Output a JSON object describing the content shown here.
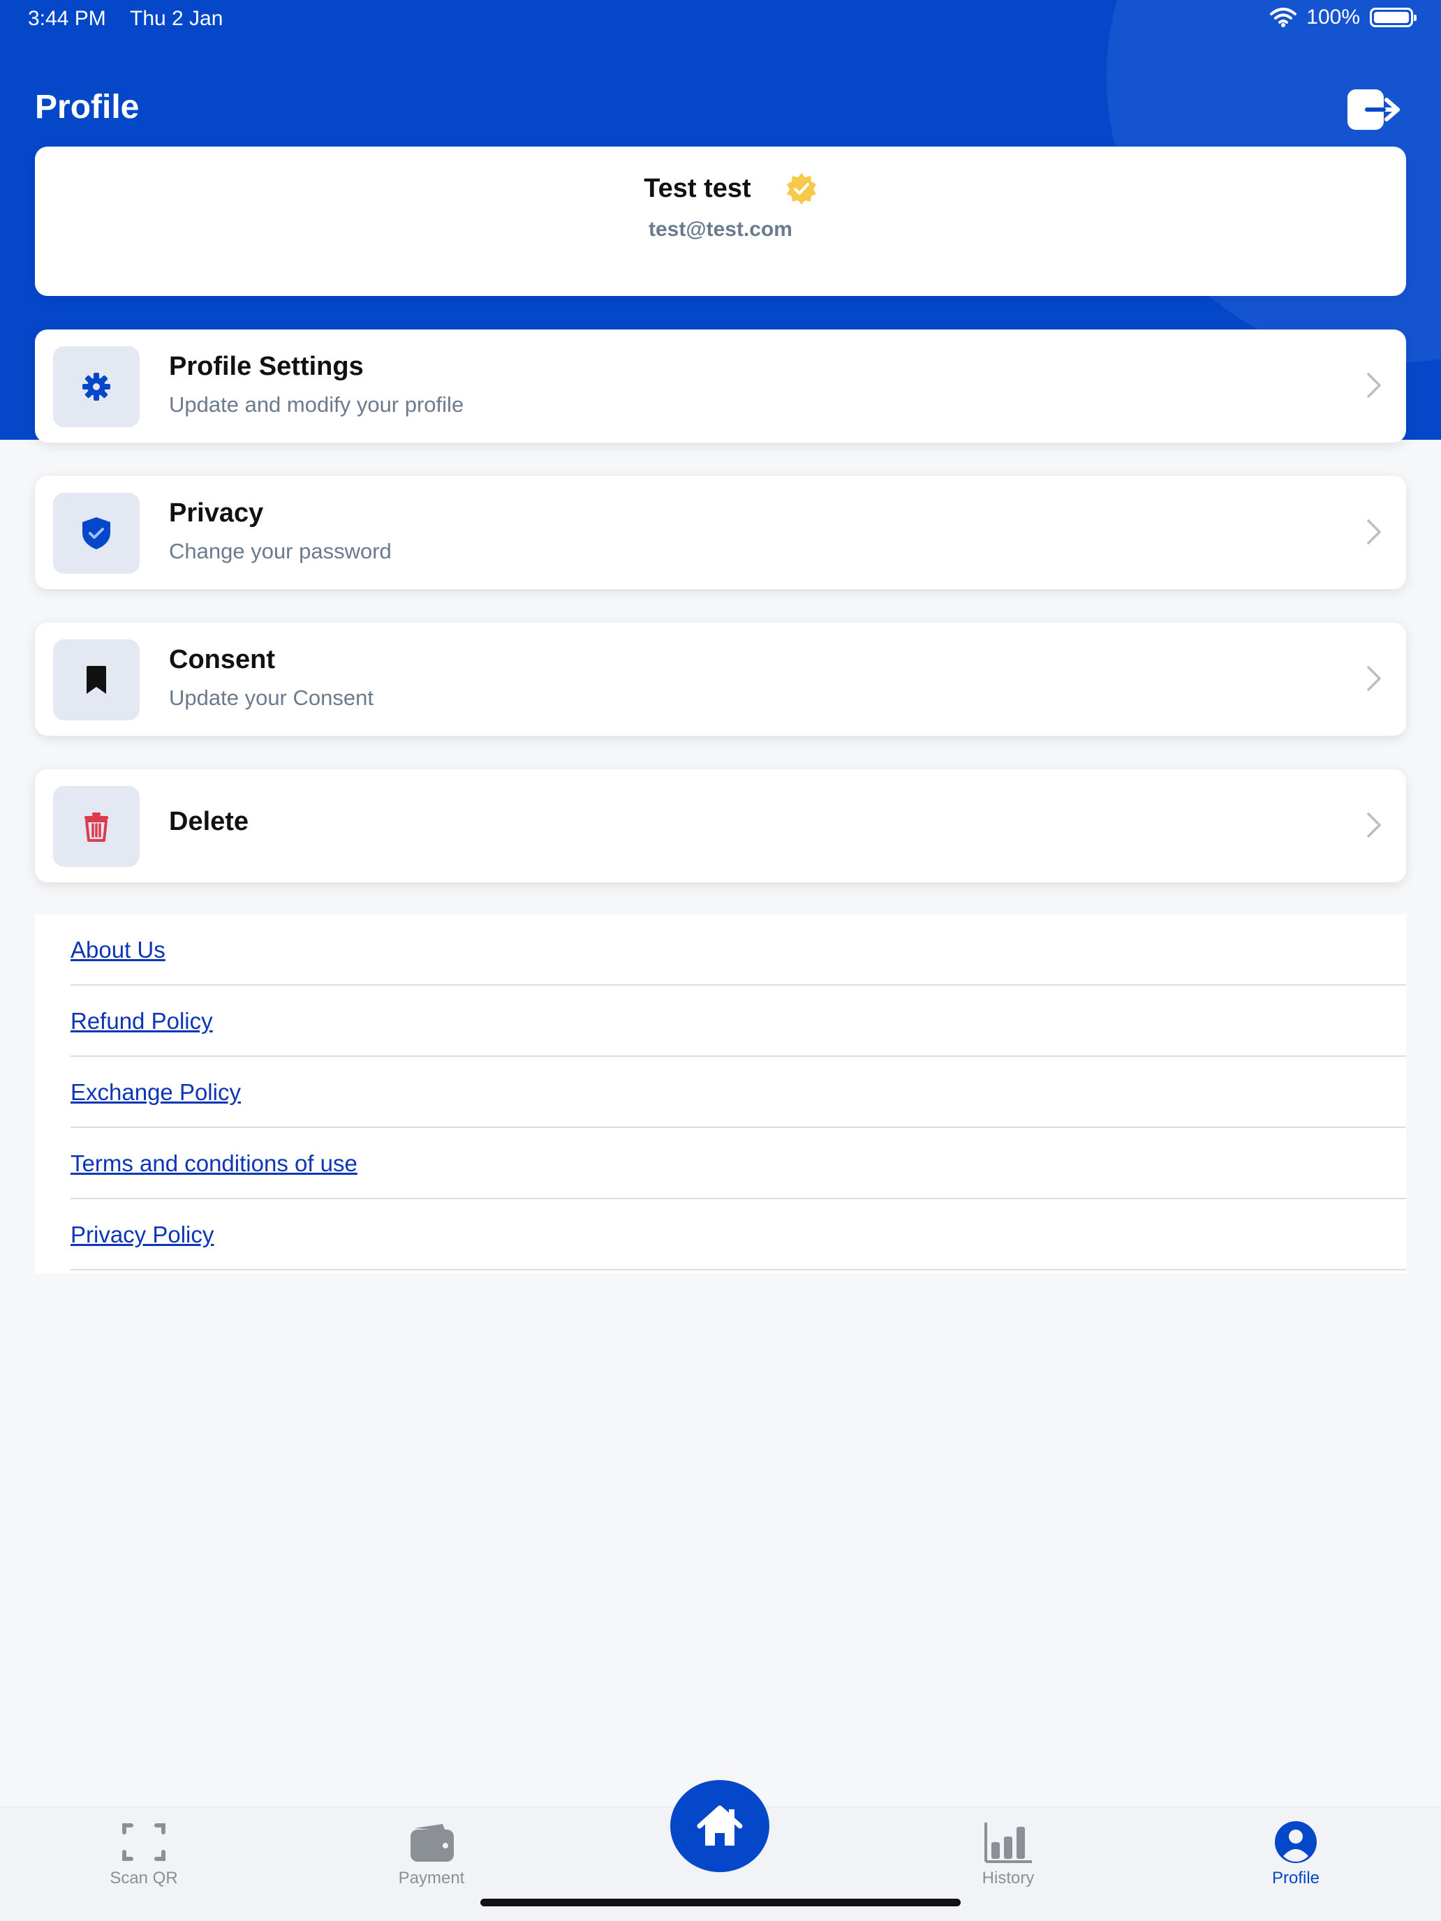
{
  "status_bar": {
    "time": "3:44 PM",
    "date": "Thu 2 Jan",
    "battery": "100%",
    "icons": [
      "wifi-icon",
      "battery-icon"
    ]
  },
  "header": {
    "title": "Profile",
    "logout_icon": "logout-icon"
  },
  "user": {
    "name": "Test test",
    "email": "test@test.com",
    "badge_icon": "verified-badge-icon",
    "badge_color": "#f6c94a"
  },
  "menu": [
    {
      "title": "Profile Settings",
      "subtitle": "Update and modify your profile",
      "icon": "gear-icon",
      "icon_color": "#0447c9"
    },
    {
      "title": "Privacy",
      "subtitle": "Change your password",
      "icon": "shield-icon",
      "icon_color": "#0447c9"
    },
    {
      "title": "Consent",
      "subtitle": "Update your Consent",
      "icon": "bookmark-icon",
      "icon_color": "#111111"
    },
    {
      "title": "Delete",
      "subtitle": "",
      "icon": "trash-icon",
      "icon_color": "#e03a4e"
    }
  ],
  "links": [
    "About Us",
    "Refund Policy",
    "Exchange Policy",
    "Terms and conditions of use",
    "Privacy Policy"
  ],
  "tabs": [
    {
      "label": "Scan QR",
      "icon": "scan-qr-icon",
      "active": false
    },
    {
      "label": "Payment",
      "icon": "wallet-icon",
      "active": false
    },
    {
      "label": "",
      "icon": "home-icon",
      "active": false
    },
    {
      "label": "History",
      "icon": "bar-chart-icon",
      "active": false
    },
    {
      "label": "Profile",
      "icon": "user-circle-icon",
      "active": true
    }
  ],
  "colors": {
    "brand": "#0447c9",
    "link": "#0d36b6",
    "muted": "#6b7a8d"
  }
}
